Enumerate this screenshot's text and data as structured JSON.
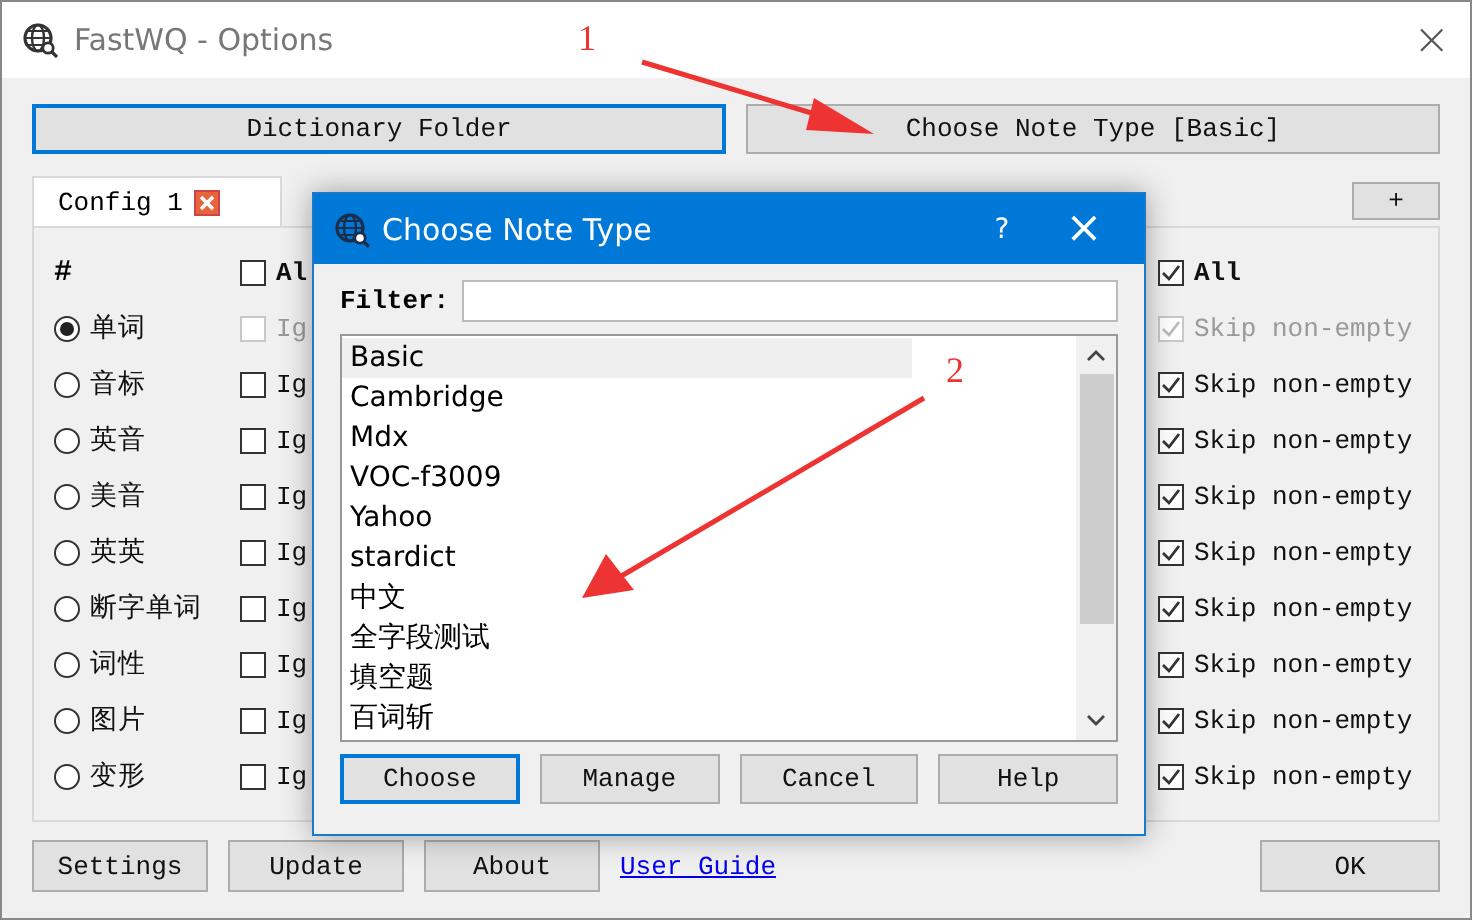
{
  "window": {
    "title": "FastWQ - Options",
    "close": "×"
  },
  "top_buttons": [
    {
      "label": "Dictionary Folder",
      "focused": true
    },
    {
      "label": "Choose Note Type [Basic]",
      "focused": false
    }
  ],
  "tabs": [
    {
      "label": "Config 1",
      "selected": true
    }
  ],
  "add_tab": "+",
  "columns": {
    "first": "#",
    "ignore_all": {
      "text": "Al",
      "checked": false
    },
    "skip_all": {
      "text": "All",
      "checked": true
    }
  },
  "fields": [
    {
      "label": "单词",
      "selected": true,
      "ignore": {
        "text": "Ig",
        "checked": false,
        "disabled": true
      },
      "skip": {
        "text": "Skip non-empty",
        "checked": true,
        "disabled": true
      }
    },
    {
      "label": "音标",
      "selected": false,
      "ignore": {
        "text": "Ig",
        "checked": false,
        "disabled": false
      },
      "skip": {
        "text": "Skip non-empty",
        "checked": true,
        "disabled": false
      }
    },
    {
      "label": "英音",
      "selected": false,
      "ignore": {
        "text": "Ig",
        "checked": false,
        "disabled": false
      },
      "skip": {
        "text": "Skip non-empty",
        "checked": true,
        "disabled": false
      }
    },
    {
      "label": "美音",
      "selected": false,
      "ignore": {
        "text": "Ig",
        "checked": false,
        "disabled": false
      },
      "skip": {
        "text": "Skip non-empty",
        "checked": true,
        "disabled": false
      }
    },
    {
      "label": "英英",
      "selected": false,
      "ignore": {
        "text": "Ig",
        "checked": false,
        "disabled": false
      },
      "skip": {
        "text": "Skip non-empty",
        "checked": true,
        "disabled": false
      }
    },
    {
      "label": "断字单词",
      "selected": false,
      "ignore": {
        "text": "Ig",
        "checked": false,
        "disabled": false
      },
      "skip": {
        "text": "Skip non-empty",
        "checked": true,
        "disabled": false
      }
    },
    {
      "label": "词性",
      "selected": false,
      "ignore": {
        "text": "Ig",
        "checked": false,
        "disabled": false
      },
      "skip": {
        "text": "Skip non-empty",
        "checked": true,
        "disabled": false
      }
    },
    {
      "label": "图片",
      "selected": false,
      "ignore": {
        "text": "Ig",
        "checked": false,
        "disabled": false
      },
      "skip": {
        "text": "Skip non-empty",
        "checked": true,
        "disabled": false
      }
    },
    {
      "label": "变形",
      "selected": false,
      "ignore": {
        "text": "Ig",
        "checked": false,
        "disabled": false
      },
      "skip": {
        "text": "Skip non-empty",
        "checked": true,
        "disabled": false
      }
    }
  ],
  "bottom": {
    "buttons": [
      "Settings",
      "Update",
      "About"
    ],
    "link": "User Guide",
    "ok": "OK"
  },
  "dialog": {
    "title": "Choose Note Type",
    "help": "?",
    "close": "×",
    "filter_label": "Filter:",
    "items": [
      {
        "label": "Basic",
        "selected": true
      },
      {
        "label": "Cambridge",
        "selected": false
      },
      {
        "label": "Mdx",
        "selected": false
      },
      {
        "label": "VOC-f3009",
        "selected": false
      },
      {
        "label": "Yahoo",
        "selected": false
      },
      {
        "label": "stardict",
        "selected": false
      },
      {
        "label": "中文",
        "selected": false
      },
      {
        "label": "全字段测试",
        "selected": false
      },
      {
        "label": "填空题",
        "selected": false
      },
      {
        "label": "百词斩",
        "selected": false
      }
    ],
    "buttons": [
      {
        "label": "Choose",
        "focused": true
      },
      {
        "label": "Manage",
        "focused": false
      },
      {
        "label": "Cancel",
        "focused": false
      },
      {
        "label": "Help",
        "focused": false
      }
    ]
  },
  "annotations": [
    "1",
    "2"
  ]
}
